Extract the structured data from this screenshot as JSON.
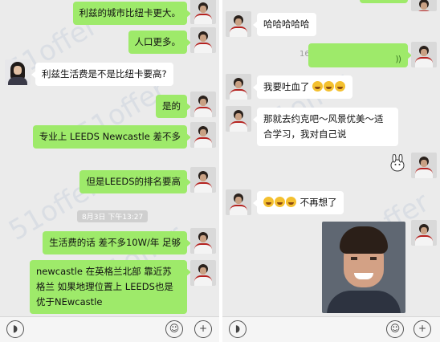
{
  "left_pane": {
    "messages": [
      {
        "side": "out",
        "text": "利兹的城市比纽卡更大。"
      },
      {
        "side": "out",
        "text": "人口更多。"
      },
      {
        "side": "in",
        "text": "利兹生活费是不是比纽卡要高?"
      },
      {
        "side": "out",
        "text": "是的"
      },
      {
        "side": "out",
        "text": "专业上 LEEDS Newcastle 差不多"
      },
      {
        "side": "out",
        "text": "但是LEEDS的排名要高"
      },
      {
        "side": "out",
        "text": "生活费的话 差不多10W/年 足够"
      },
      {
        "side": "out",
        "text": "newcastle 在英格兰北部 靠近苏格兰 如果地理位置上 LEEDS也是优于NEwcastle"
      }
    ],
    "timestamp": "8月3日 下午13:27"
  },
  "right_pane": {
    "messages": [
      {
        "side": "in",
        "text": "哈哈哈哈哈"
      },
      {
        "side": "out",
        "type": "voice",
        "duration": "16\""
      },
      {
        "side": "in",
        "text": "我要吐血了"
      },
      {
        "side": "in",
        "text": "那就去约克吧～风景优美～适合学习，我对自己说"
      },
      {
        "side": "out",
        "type": "sticker"
      },
      {
        "side": "in",
        "text": "不再想了"
      },
      {
        "side": "in",
        "type": "image"
      }
    ]
  },
  "watermark": {
    "text": "51offer"
  },
  "colors": {
    "sent_bubble": "#9eea6a",
    "received_bubble": "#ffffff",
    "background": "#ebebeb"
  },
  "icons": {
    "voice_toggle": "voice-icon",
    "emoji_button": "smile-icon",
    "more_button": "plus-icon"
  }
}
